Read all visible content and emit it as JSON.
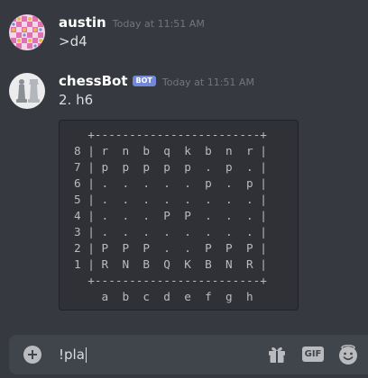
{
  "messages": [
    {
      "username": "austin",
      "timestamp": "Today at 11:51 AM",
      "content": ">d4",
      "avatar_icon": "checkered-avatar-icon"
    },
    {
      "username": "chessBot",
      "bot_tag": "BOT",
      "timestamp": "Today at 11:51 AM",
      "content": "2. h6",
      "avatar_icon": "chess-pieces-avatar-icon",
      "board": "  +------------------------+\n8 | r  n  b  q  k  b  n  r |\n7 | p  p  p  p  p  .  p  . |\n6 | .  .  .  .  .  p  .  p |\n5 | .  .  .  .  .  .  .  . |\n4 | .  .  .  P  P  .  .  . |\n3 | .  .  .  .  .  .  .  . |\n2 | P  P  P  .  .  P  P  P |\n1 | R  N  B  Q  K  B  N  R |\n  +------------------------+\n    a  b  c  d  e  f  g  h"
    }
  ],
  "composer": {
    "value": "!pla",
    "gif_label": "GIF"
  },
  "colors": {
    "background": "#36393f",
    "code_background": "#2f3136",
    "bot_tag": "#7289da",
    "username": "#ffffff",
    "timestamp": "#72767d",
    "text": "#dcddde"
  }
}
